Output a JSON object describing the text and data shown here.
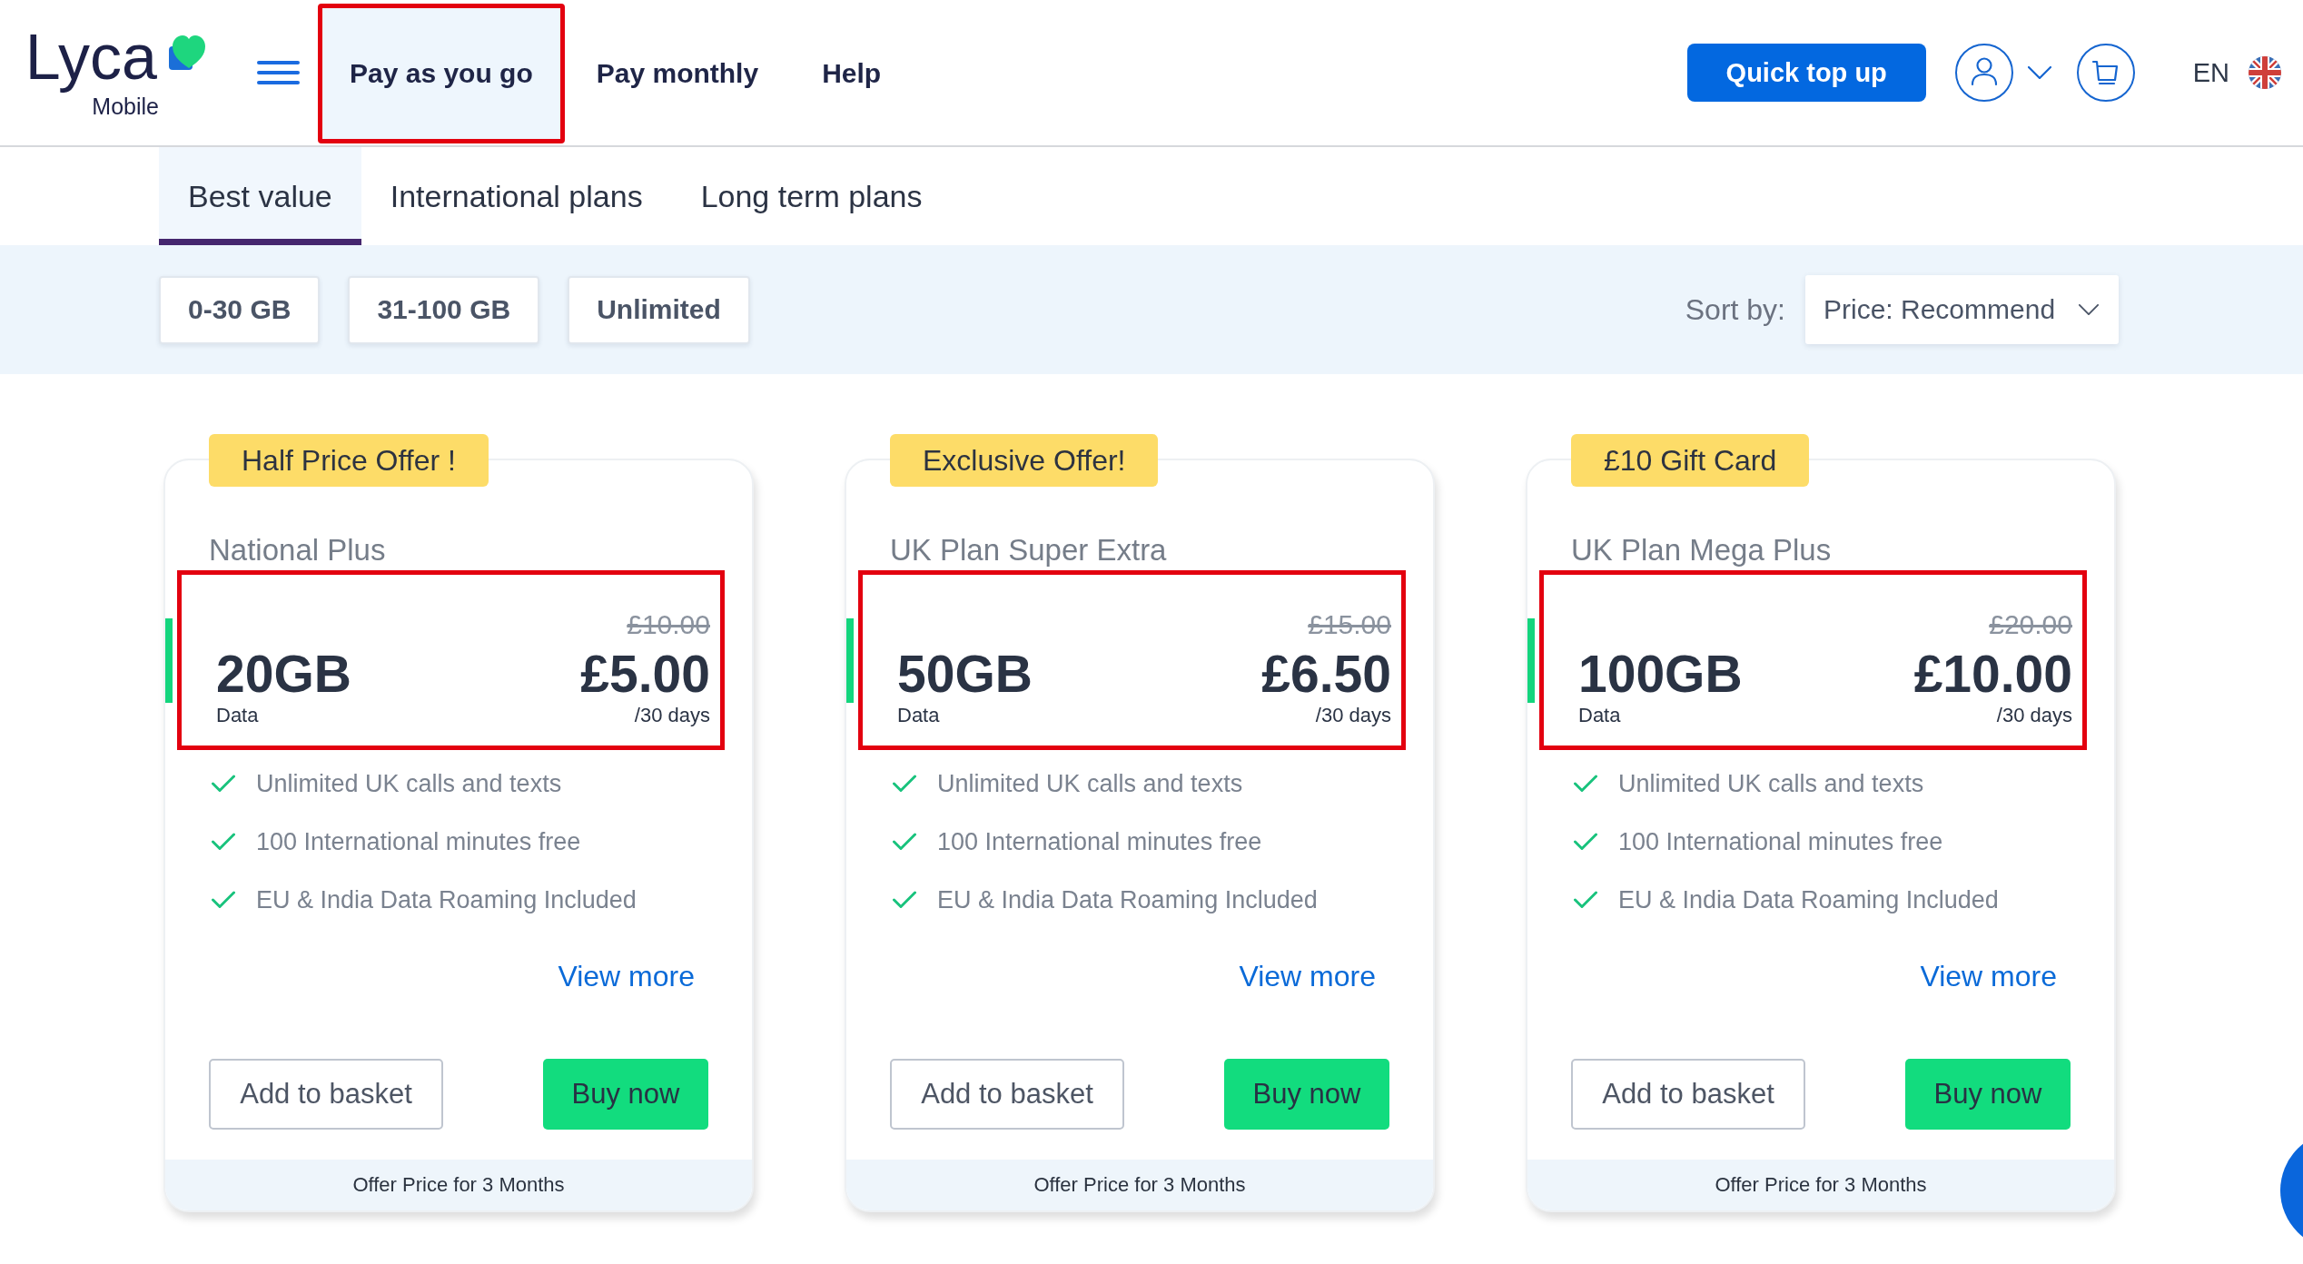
{
  "header": {
    "logo": {
      "wordmark": "Lyca",
      "tagline": "Mobile"
    },
    "nav": [
      {
        "label": "Pay as you go",
        "selected": true,
        "highlighted": true
      },
      {
        "label": "Pay monthly",
        "selected": false,
        "highlighted": false
      },
      {
        "label": "Help",
        "selected": false,
        "highlighted": false
      }
    ],
    "quick_top_up": "Quick top up",
    "language": "EN"
  },
  "tabs": [
    {
      "label": "Best value",
      "selected": true
    },
    {
      "label": "International plans",
      "selected": false
    },
    {
      "label": "Long term plans",
      "selected": false
    }
  ],
  "filters": {
    "chips": [
      {
        "label": "0-30 GB",
        "selected": false
      },
      {
        "label": "31-100 GB",
        "selected": false
      },
      {
        "label": "Unlimited",
        "selected": false
      }
    ],
    "sort_label": "Sort by:",
    "sort_value": "Price: Recommend"
  },
  "cards": [
    {
      "badge": "Half Price Offer !",
      "name": "National Plus",
      "highlighted": true,
      "data": "20GB",
      "data_label": "Data",
      "old_price": "£10.00",
      "price": "£5.00",
      "period": "/30 days",
      "features": [
        "Unlimited UK calls and texts",
        "100 International minutes free",
        "EU & India Data Roaming Included"
      ],
      "view_more": "View more",
      "add_to_basket": "Add to basket",
      "buy_now": "Buy now",
      "footer": "Offer Price for 3 Months"
    },
    {
      "badge": "Exclusive Offer!",
      "name": "UK Plan Super Extra",
      "highlighted": true,
      "data": "50GB",
      "data_label": "Data",
      "old_price": "£15.00",
      "price": "£6.50",
      "period": "/30 days",
      "features": [
        "Unlimited UK calls and texts",
        "100 International minutes free",
        "EU & India Data Roaming Included"
      ],
      "view_more": "View more",
      "add_to_basket": "Add to basket",
      "buy_now": "Buy now",
      "footer": "Offer Price for 3 Months"
    },
    {
      "badge": "£10 Gift Card",
      "name": "UK Plan Mega Plus",
      "highlighted": true,
      "data": "100GB",
      "data_label": "Data",
      "old_price": "£20.00",
      "price": "£10.00",
      "period": "/30 days",
      "features": [
        "Unlimited UK calls and texts",
        "100 International minutes free",
        "EU & India Data Roaming Included"
      ],
      "view_more": "View more",
      "add_to_basket": "Add to basket",
      "buy_now": "Buy now",
      "footer": "Offer Price for 3 Months"
    }
  ]
}
